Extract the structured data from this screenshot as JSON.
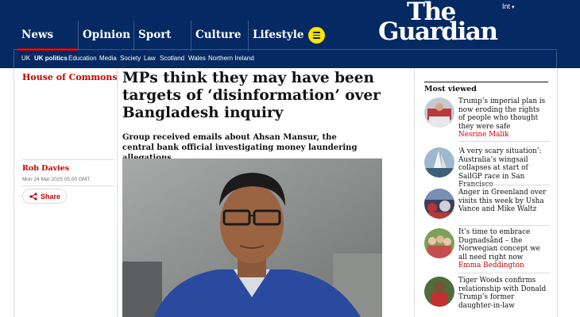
{
  "header": {
    "edition": "Int",
    "logo_line1": "The",
    "logo_line2": "Guardian",
    "pillars": [
      "News",
      "Opinion",
      "Sport",
      "Culture",
      "Lifestyle"
    ],
    "subnav": [
      "UK",
      "UK politics",
      "Education",
      "Media",
      "Society",
      "Law",
      "Scotland",
      "Wales",
      "Northern Ireland"
    ]
  },
  "article": {
    "section": "House of Commons",
    "headline": "MPs think they may have been targets of ‘disinformation’ over Bangladesh inquiry",
    "standfirst": "Group received emails about Ahsan Mansur, the central bank official investigating money laundering allegations",
    "byline": "Rob Davies",
    "date": "Mon 24 Mar 2025 05.00 GMT",
    "share_label": "Share"
  },
  "most_viewed": {
    "title": "Most viewed",
    "items": [
      {
        "headline": "Trump’s imperial plan is now eroding the rights of people who thought they were safe",
        "author": "Nesrine Malik"
      },
      {
        "headline": "‘A very scary situation’: Australia’s wingsail collapses at start of SailGP race in San Francisco",
        "author": ""
      },
      {
        "headline": "Anger in Greenland over visits this week by Usha Vance and Mike Waltz",
        "author": ""
      },
      {
        "headline": "It’s time to embrace Dugnadsånd – the Norwegian concept we all need right now",
        "author": "Emma Beddington"
      },
      {
        "headline": "Tiger Woods confirms relationship with Donald Trump’s former daughter-in-law",
        "author": ""
      }
    ]
  },
  "colors": {
    "brand_blue": "#052962",
    "news_red": "#c70000",
    "menu_yellow": "#ffe500"
  },
  "icons": [
    "menu-icon",
    "share-icon",
    "caret-down-icon"
  ]
}
